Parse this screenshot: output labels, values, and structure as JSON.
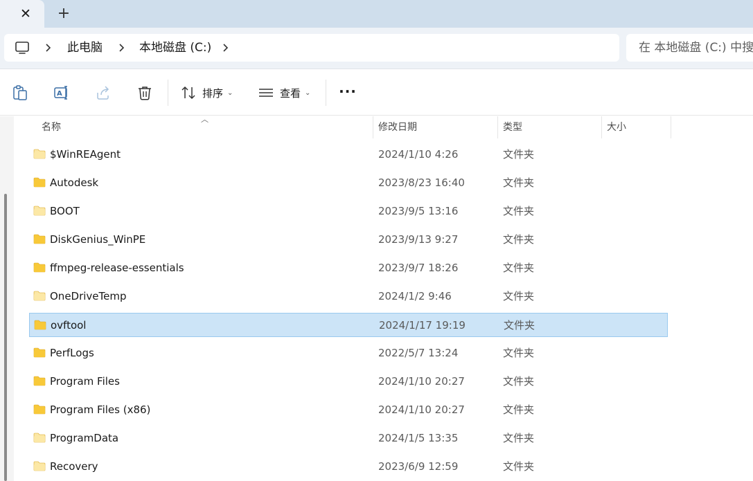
{
  "tabs": {
    "close_symbol": "✕",
    "new_symbol": "+"
  },
  "breadcrumb": [
    "此电脑",
    "本地磁盘 (C:)"
  ],
  "search": {
    "placeholder": "在 本地磁盘 (C:) 中搜索"
  },
  "toolbar": {
    "icons": [
      "paste-icon",
      "rename-icon",
      "share-icon",
      "delete-icon"
    ],
    "sort_label": "排序",
    "view_label": "查看",
    "more_symbol": "···"
  },
  "columns": {
    "name": "名称",
    "modified": "修改日期",
    "type": "类型",
    "size": "大小"
  },
  "files": [
    {
      "name": "$WinREAgent",
      "modified": "2024/1/10 4:26",
      "type": "文件夹",
      "size": "",
      "faded": true,
      "selected": false
    },
    {
      "name": "Autodesk",
      "modified": "2023/8/23 16:40",
      "type": "文件夹",
      "size": "",
      "faded": false,
      "selected": false
    },
    {
      "name": "BOOT",
      "modified": "2023/9/5 13:16",
      "type": "文件夹",
      "size": "",
      "faded": true,
      "selected": false
    },
    {
      "name": "DiskGenius_WinPE",
      "modified": "2023/9/13 9:27",
      "type": "文件夹",
      "size": "",
      "faded": false,
      "selected": false
    },
    {
      "name": "ffmpeg-release-essentials",
      "modified": "2023/9/7 18:26",
      "type": "文件夹",
      "size": "",
      "faded": false,
      "selected": false
    },
    {
      "name": "OneDriveTemp",
      "modified": "2024/1/2 9:46",
      "type": "文件夹",
      "size": "",
      "faded": true,
      "selected": false
    },
    {
      "name": "ovftool",
      "modified": "2024/1/17 19:19",
      "type": "文件夹",
      "size": "",
      "faded": false,
      "selected": true
    },
    {
      "name": "PerfLogs",
      "modified": "2022/5/7 13:24",
      "type": "文件夹",
      "size": "",
      "faded": false,
      "selected": false
    },
    {
      "name": "Program Files",
      "modified": "2024/1/10 20:27",
      "type": "文件夹",
      "size": "",
      "faded": false,
      "selected": false
    },
    {
      "name": "Program Files (x86)",
      "modified": "2024/1/10 20:27",
      "type": "文件夹",
      "size": "",
      "faded": false,
      "selected": false
    },
    {
      "name": "ProgramData",
      "modified": "2024/1/5 13:35",
      "type": "文件夹",
      "size": "",
      "faded": true,
      "selected": false
    },
    {
      "name": "Recovery",
      "modified": "2023/6/9 12:59",
      "type": "文件夹",
      "size": "",
      "faded": true,
      "selected": false
    }
  ],
  "colors": {
    "tabstrip": "#cfdeec",
    "selection": "#cce4f7",
    "selection_border": "#99c9ef",
    "folder": "#f8c93a",
    "folder_faded": "#fbe7a6"
  }
}
